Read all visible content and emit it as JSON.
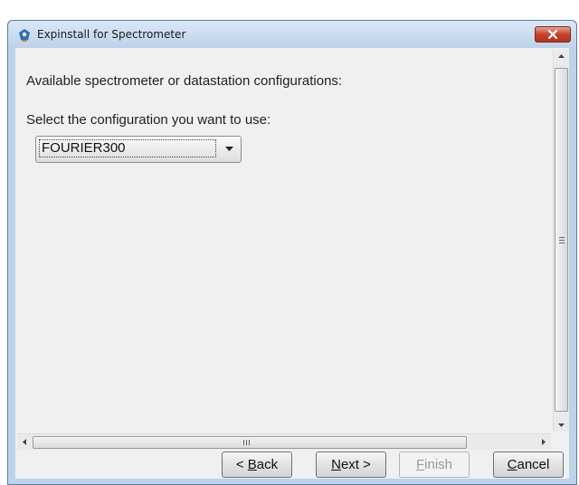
{
  "window": {
    "title": "Expinstall for Spectrometer",
    "icon": "spectrometer-app-icon"
  },
  "content": {
    "heading": "Available spectrometer or datastation configurations:",
    "prompt": "Select the configuration you want to use:",
    "configuration_select": {
      "selected": "FOURIER300"
    }
  },
  "scrollbars": {
    "horizontal_grip": "III"
  },
  "buttons": {
    "back": {
      "prefix": "< ",
      "mnemonic": "B",
      "rest": "ack"
    },
    "next": {
      "mnemonic": "N",
      "rest": "ext >"
    },
    "finish": {
      "mnemonic": "F",
      "rest": "inish"
    },
    "cancel": {
      "mnemonic": "C",
      "rest": "ancel"
    }
  },
  "colors": {
    "window_frame": "#bcd3ea",
    "close_button": "#c5432b",
    "client_bg": "#f0f0f0"
  }
}
